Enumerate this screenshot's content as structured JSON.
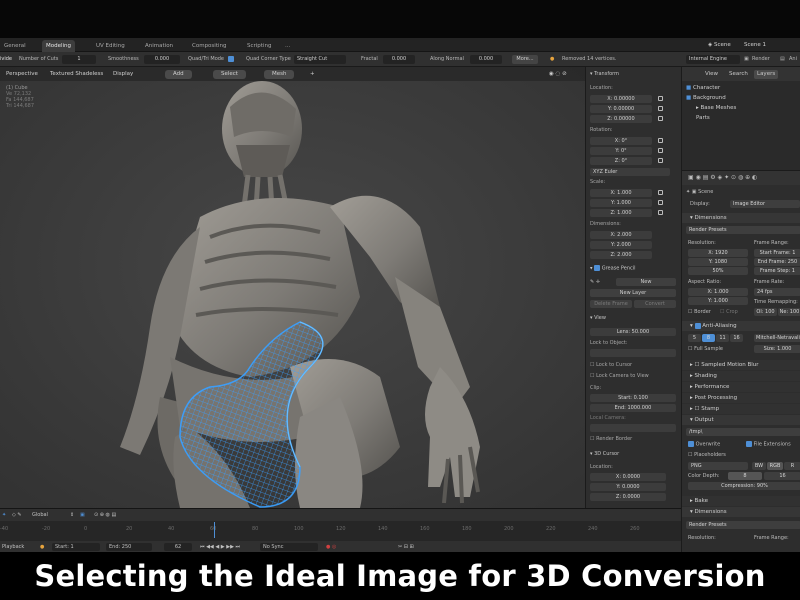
{
  "workspace_tabs": [
    "General",
    "Modeling",
    "UV Editing",
    "Animation",
    "Compositing",
    "Scripting",
    "..."
  ],
  "active_tab": "Modeling",
  "scene_label": "Scene",
  "scene_name": "Scene 1",
  "toolbar": {
    "mode": "ivide",
    "cuts_label": "Number of Cuts",
    "cuts_value": "1",
    "smoothness_label": "Smoothness",
    "smoothness_value": "0.000",
    "quadtri_label": "Quad/Tri Mode",
    "corner_label": "Quad Corner Type",
    "corner_value": "Straight Cut",
    "fractal_label": "Fractal",
    "fractal_value": "0.000",
    "normal_label": "Along Normal",
    "normal_value": "0.000",
    "more_label": "More...",
    "status": "Removed 14 vertices.",
    "engine": "Internal Engine",
    "render_label": "Render",
    "anim_label": "Ani"
  },
  "viewport": {
    "perspective": "Perspective",
    "shading": "Textured Shadeless",
    "display": "Display",
    "add": "Add",
    "select": "Select",
    "mesh": "Mesh",
    "object_name": "(1) Cube",
    "stats": [
      {
        "label": "Ve",
        "value": "72,132"
      },
      {
        "label": "Fa",
        "value": "144,687"
      },
      {
        "label": "Tri",
        "value": "144,687"
      }
    ]
  },
  "npanel": {
    "transform_title": "Transform",
    "location_label": "Location:",
    "location": [
      "X: 0.00000",
      "Y: 0.00000",
      "Z: 0.00000"
    ],
    "rotation_label": "Rotation:",
    "rotation": [
      "X: 0°",
      "Y: 0°",
      "Z: 0°"
    ],
    "rotation_mode": "XYZ Euler",
    "scale_label": "Scale:",
    "scale": [
      "X: 1.000",
      "Y: 1.000",
      "Z: 1.000"
    ],
    "dimensions_label": "Dimensions:",
    "dimensions": [
      "X: 2.000",
      "Y: 2.000",
      "Z: 2.000"
    ],
    "grease_title": "Grease Pencil",
    "gp_new": "New",
    "gp_new_layer": "New Layer",
    "gp_delete": "Delete Frame",
    "gp_convert": "Convert",
    "view_title": "View",
    "lens": "Lens: 50.000",
    "lock_object": "Lock to Object:",
    "lock_cursor": "Lock to Cursor",
    "lock_camera": "Lock Camera to View",
    "clip_label": "Clip:",
    "clip_start": "Start: 0.100",
    "clip_end": "End: 1000.000",
    "local_camera": "Local Camera:",
    "render_border": "Render Border",
    "cursor_title": "3D Cursor",
    "cursor_location_label": "Location:",
    "cursor_location": [
      "X: 0.0000",
      "Y: 0.0000",
      "Z: 0.0000"
    ]
  },
  "outliner": {
    "view_tab": "View",
    "search_tab": "Search",
    "layers_tab": "Layers",
    "rows": [
      "Character",
      "Background",
      "Base Meshes",
      "Parts"
    ]
  },
  "properties": {
    "scene": "Scene",
    "display_label": "Display:",
    "display_value": "Image Editor",
    "dimensions_title": "Dimensions",
    "render_presets": "Render Presets",
    "resolution_label": "Resolution:",
    "res_x": "X: 1920",
    "res_y": "Y: 1080",
    "res_pct": "50%",
    "frame_range_label": "Frame Range:",
    "start_frame": "Start Frame: 1",
    "end_frame": "End Frame: 250",
    "frame_step": "Frame Step: 1",
    "aspect_label": "Aspect Ratio:",
    "aspect_x": "X: 1.000",
    "aspect_y": "Y: 1.000",
    "frame_rate_label": "Frame Rate:",
    "frame_rate": "24 fps",
    "time_remap_label": "Time Remapping:",
    "time_old": "Ol: 100",
    "time_new": "Ne: 100",
    "border": "Border",
    "crop": "Crop",
    "aa_title": "Anti-Aliasing",
    "aa_samples": [
      "5",
      "8",
      "11",
      "16"
    ],
    "aa_filter": "Mitchell-Netravali",
    "full_sample": "Full Sample",
    "aa_size": "Size: 1.000",
    "sections": [
      "Sampled Motion Blur",
      "Shading",
      "Performance",
      "Post Processing",
      "Stamp",
      "Output"
    ],
    "output_path": "/tmp\\",
    "overwrite": "Overwrite",
    "file_ext": "File Extensions",
    "placeholders": "Placeholders",
    "format": "PNG",
    "bw": "BW",
    "rgb": "RGB",
    "rgba": "R",
    "color_depth_label": "Color Depth:",
    "depth_8": "8",
    "depth_16": "16",
    "compression": "Compression: 90%",
    "bottom_sections": [
      "Bake",
      "Dimensions"
    ],
    "render_presets2": "Render Presets",
    "resolution_label2": "Resolution:",
    "frame_range_label2": "Frame Range:"
  },
  "timeline": {
    "orientation": "Global",
    "ticks": [
      "-40",
      "-20",
      "0",
      "20",
      "40",
      "60",
      "80",
      "100",
      "120",
      "140",
      "160",
      "180",
      "200",
      "220",
      "240",
      "260"
    ],
    "playback": "Playback",
    "start": "Start: 1",
    "end": "End: 250",
    "current": "62",
    "sync": "No Sync",
    "current_frame_value": 62
  },
  "caption": "Selecting the Ideal Image for 3D Conversion",
  "colors": {
    "accent": "#4e8fd6",
    "mesh_highlight": "#3aa0ff",
    "figure": "#8a8782"
  }
}
